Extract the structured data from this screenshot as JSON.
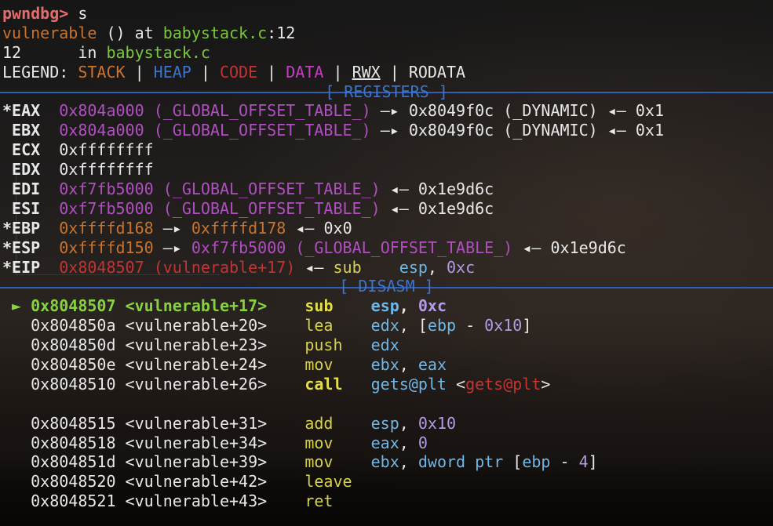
{
  "prompt": {
    "label": "pwndbg>",
    "command": "s"
  },
  "location": {
    "func": "vulnerable",
    "middle": " () at ",
    "file": "babystack.c",
    "line_suffix": ":12"
  },
  "source_line": {
    "number": "12",
    "spacer": "      in ",
    "file": "babystack.c"
  },
  "legend": {
    "label": "LEGEND: ",
    "stack": "STACK",
    "heap": "HEAP",
    "code": "CODE",
    "data": "DATA",
    "rwx": "RWX",
    "rodata": "RODATA",
    "sep": " | "
  },
  "headers": {
    "registers": "[ REGISTERS ]",
    "disasm": "[ DISASM ]"
  },
  "registers": {
    "eax": {
      "star": "*",
      "name": "EAX",
      "val": "0x804a000",
      "sym": "(_GLOBAL_OFFSET_TABLE_)",
      "arrow1": "—▸",
      "val2": "0x8049f0c",
      "sym2": "(_DYNAMIC)",
      "arrow2": "◂—",
      "val3": "0x1"
    },
    "ebx": {
      "star": " ",
      "name": "EBX",
      "val": "0x804a000",
      "sym": "(_GLOBAL_OFFSET_TABLE_)",
      "arrow1": "—▸",
      "val2": "0x8049f0c",
      "sym2": "(_DYNAMIC)",
      "arrow2": "◂—",
      "val3": "0x1"
    },
    "ecx": {
      "star": " ",
      "name": "ECX",
      "val": "0xffffffff"
    },
    "edx": {
      "star": " ",
      "name": "EDX",
      "val": "0xffffffff"
    },
    "edi": {
      "star": " ",
      "name": "EDI",
      "val": "0xf7fb5000",
      "sym": "(_GLOBAL_OFFSET_TABLE_)",
      "arrow": "◂—",
      "val2": "0x1e9d6c"
    },
    "esi": {
      "star": " ",
      "name": "ESI",
      "val": "0xf7fb5000",
      "sym": "(_GLOBAL_OFFSET_TABLE_)",
      "arrow": "◂—",
      "val2": "0x1e9d6c"
    },
    "ebp": {
      "star": "*",
      "name": "EBP",
      "val": "0xffffd168",
      "arrow1": "—▸",
      "val2": "0xffffd178",
      "arrow2": "◂—",
      "val3": "0x0"
    },
    "esp": {
      "star": "*",
      "name": "ESP",
      "val": "0xffffd150",
      "arrow1": "—▸",
      "val2": "0xf7fb5000",
      "sym2": "(_GLOBAL_OFFSET_TABLE_)",
      "arrow2": "◂—",
      "val3": "0x1e9d6c"
    },
    "eip": {
      "star": "*",
      "name": "EIP",
      "val": "0x8048507",
      "sym": "(vulnerable+17)",
      "arrow": "◂—",
      "mnem": "sub",
      "ops_reg": "esp",
      "ops_comma": ", ",
      "ops_imm": "0xc"
    }
  },
  "disasm": {
    "current_marker": "►",
    "rows": [
      {
        "addr": "0x8048507",
        "sym": "<vulnerable+17>",
        "mnem": "sub",
        "op_a": "esp",
        "op_b": "0xc",
        "current": true
      },
      {
        "addr": "0x804850a",
        "sym": "<vulnerable+20>",
        "mnem": "lea",
        "op_a": "edx",
        "op_mem_open": "[",
        "op_mem_reg": "ebp",
        "op_mem_sign": " - ",
        "op_mem_imm": "0x10",
        "op_mem_close": "]"
      },
      {
        "addr": "0x804850d",
        "sym": "<vulnerable+23>",
        "mnem": "push",
        "op_a": "edx"
      },
      {
        "addr": "0x804850e",
        "sym": "<vulnerable+24>",
        "mnem": "mov",
        "op_a": "ebx",
        "op_b": "eax"
      },
      {
        "addr": "0x8048510",
        "sym": "<vulnerable+26>",
        "mnem": "call",
        "call_target": "gets@plt",
        "call_sym_open": "<",
        "call_sym": "gets@plt",
        "call_sym_close": ">"
      },
      {
        "addr": "0x8048515",
        "sym": "<vulnerable+31>",
        "mnem": "add",
        "op_a": "esp",
        "op_b": "0x10"
      },
      {
        "addr": "0x8048518",
        "sym": "<vulnerable+34>",
        "mnem": "mov",
        "op_a": "eax",
        "op_b": "0"
      },
      {
        "addr": "0x804851d",
        "sym": "<vulnerable+39>",
        "mnem": "mov",
        "op_a": "ebx",
        "op_size": "dword ptr",
        "op_mem_open": "[",
        "op_mem_reg": "ebp",
        "op_mem_sign": " - ",
        "op_mem_imm": "4",
        "op_mem_close": "]"
      },
      {
        "addr": "0x8048520",
        "sym": "<vulnerable+42>",
        "mnem": "leave"
      },
      {
        "addr": "0x8048521",
        "sym": "<vulnerable+43>",
        "mnem": "ret"
      }
    ]
  },
  "colors": {
    "stack": "#c9742e",
    "heap": "#3b74c9",
    "code": "#c23434",
    "data": "#c23fc2",
    "header": "#3b74c9",
    "mnemonic": "#d6d24a",
    "current": "#86d33f"
  }
}
